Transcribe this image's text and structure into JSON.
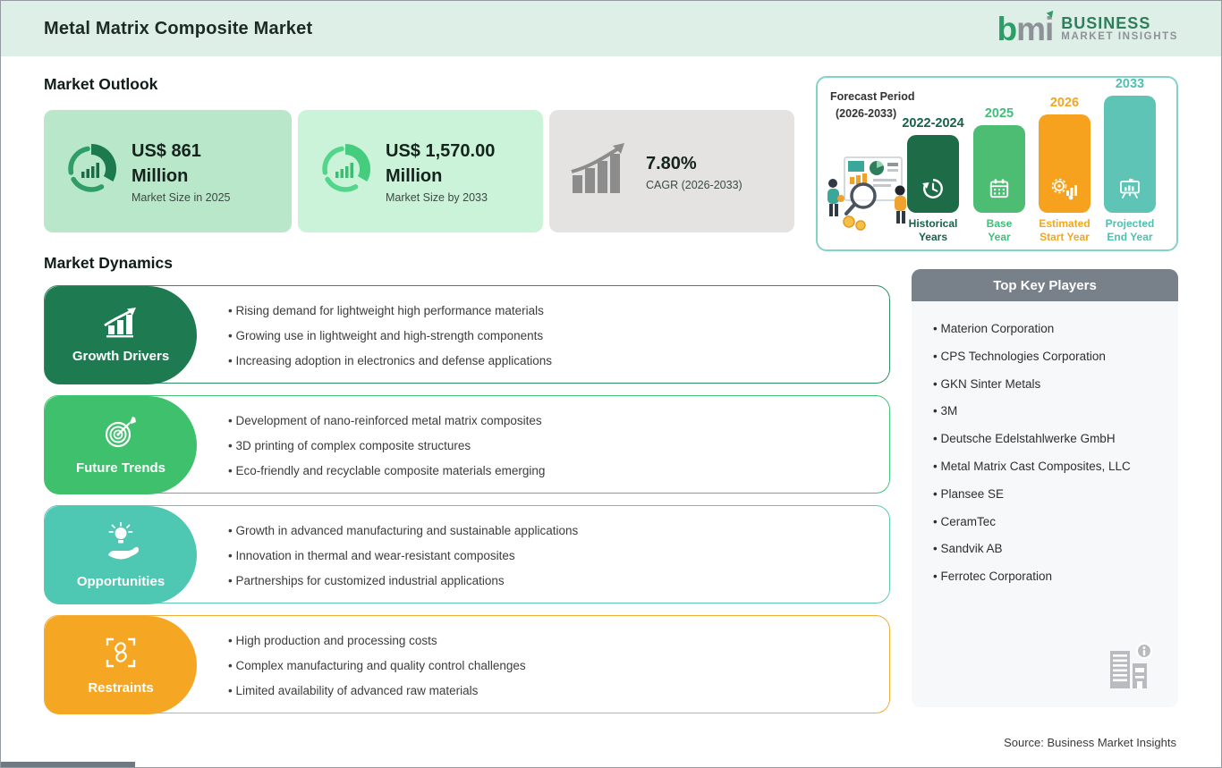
{
  "header": {
    "title": "Metal Matrix Composite Market",
    "logo": {
      "mark_b": "b",
      "mark_mi": "mi",
      "name_line1": "BUSINESS",
      "name_line2": "MARKET INSIGHTS"
    }
  },
  "market_outlook": {
    "heading": "Market Outlook",
    "cards": [
      {
        "icon": "donut-chart-icon",
        "bg": "#b9e7ca",
        "value_line1": "US$ 861",
        "value_line2": "Million",
        "caption": "Market Size in 2025"
      },
      {
        "icon": "donut-chart-icon",
        "bg": "#cbf3da",
        "value_line1": "US$ 1,570.00",
        "value_line2": "Million",
        "caption": "Market Size by 2033"
      },
      {
        "icon": "growth-arrow-icon",
        "bg": "#e4e3e2",
        "value_line1": "7.80%",
        "caption": "CAGR (2026-2033)"
      }
    ]
  },
  "forecast_panel": {
    "label_line1": "Forecast Period",
    "label_line2": "(2026-2033)",
    "border_color": "#82d3c6",
    "bars": [
      {
        "year": "2022-2024",
        "label_line1": "Historical",
        "label_line2": "Years",
        "color": "#1e6b48",
        "icon": "history-clock-icon"
      },
      {
        "year": "2025",
        "label_line1": "Base",
        "label_line2": "Year",
        "color": "#4cbd72",
        "icon": "calendar-icon"
      },
      {
        "year": "2026",
        "label_line1": "Estimated",
        "label_line2": "Start Year",
        "color": "#f6a21e",
        "icon": "estimate-gear-icon"
      },
      {
        "year": "2033",
        "label_line1": "Projected",
        "label_line2": "End Year",
        "color": "#5ec4b5",
        "icon": "presentation-icon"
      }
    ]
  },
  "market_dynamics": {
    "heading": "Market Dynamics",
    "sections": [
      {
        "title": "Growth Drivers",
        "color": "#1e7a50",
        "icon": "bar-growth-icon",
        "bullets": [
          "Rising demand for lightweight high performance materials",
          "Growing use in lightweight and high-strength components",
          "Increasing adoption in electronics and defense applications"
        ]
      },
      {
        "title": "Future Trends",
        "color": "#3ec06c",
        "icon": "target-icon",
        "bullets": [
          "Development of nano-reinforced metal matrix composites",
          "3D printing of complex composite structures",
          "Eco-friendly and recyclable composite materials emerging"
        ]
      },
      {
        "title": "Opportunities",
        "color": "#4ec7b3",
        "icon": "bulb-hand-icon",
        "bullets": [
          "Growth in advanced manufacturing and sustainable applications",
          "Innovation in thermal and wear-resistant composites",
          "Partnerships for customized industrial applications"
        ]
      },
      {
        "title": "Restraints",
        "color": "#f5a623",
        "icon": "chain-icon",
        "bullets": [
          "High production and processing costs",
          "Complex manufacturing and quality control challenges",
          "Limited availability of advanced raw materials"
        ]
      }
    ]
  },
  "key_players": {
    "heading": "Top Key Players",
    "header_bg": "#78818a",
    "items": [
      "Materion Corporation",
      "CPS Technologies Corporation",
      "GKN Sinter Metals",
      "3M",
      "Deutsche Edelstahlwerke GmbH",
      "Metal Matrix Cast Composites, LLC",
      "Plansee SE",
      "CeramTec",
      "Sandvik AB",
      "Ferrotec Corporation"
    ]
  },
  "footer": {
    "source": "Source: Business Market Insights"
  }
}
